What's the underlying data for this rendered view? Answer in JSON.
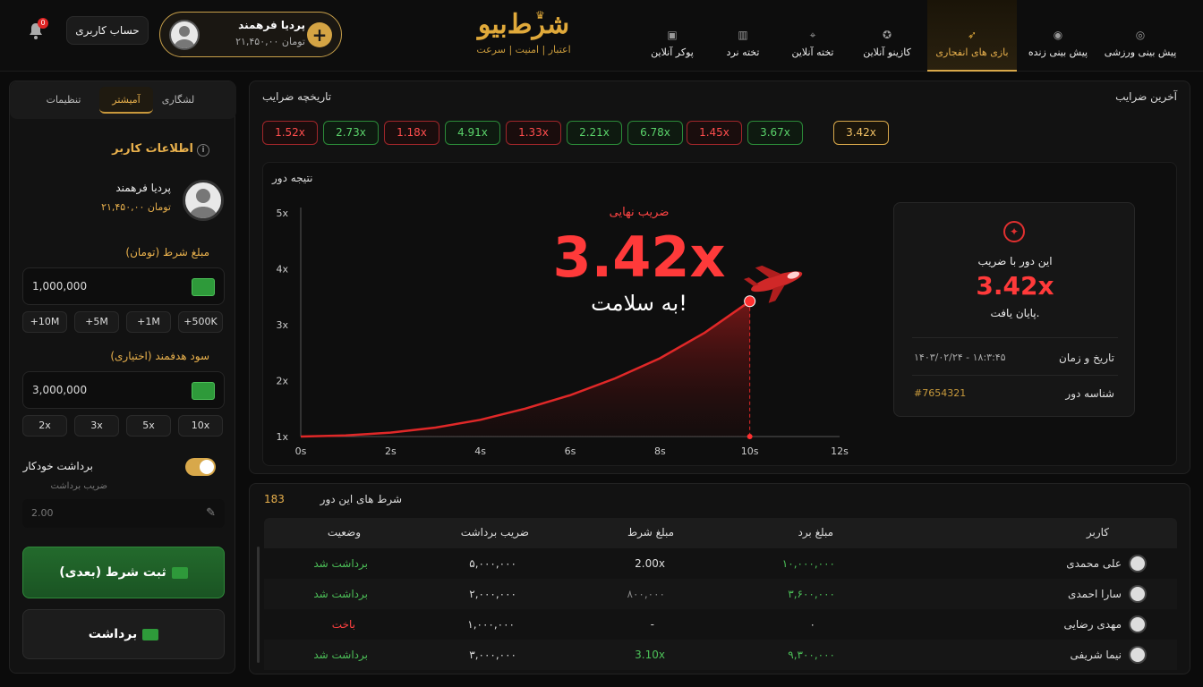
{
  "header": {
    "notification_count": "0",
    "account_button": "حساب کاربری",
    "wallet": {
      "name": "پردیا فرهمند",
      "balance": "۲۱,۴۵۰,۰۰ تومان",
      "add": "+"
    },
    "logo": {
      "title": "شرط‌بیو",
      "tagline": "اعتبار | امنیت | سرعت"
    },
    "nav": [
      {
        "label": "پیش بینی ورزشی",
        "icon": "ball-icon"
      },
      {
        "label": "پیش بینی زنده",
        "icon": "live-icon"
      },
      {
        "label": "بازی های انفجاری",
        "icon": "rocket-icon",
        "active": true
      },
      {
        "label": "کازینو آنلاین",
        "icon": "chip-icon"
      },
      {
        "label": "تخته آنلاین",
        "icon": "antenna-icon"
      },
      {
        "label": "تخته نرد",
        "icon": "board-icon"
      },
      {
        "label": "پوکر آنلاین",
        "icon": "cards-icon"
      }
    ]
  },
  "sidebar": {
    "tabs": [
      "تنظیمات",
      "آمیشتر",
      "لشگاری"
    ],
    "user_info_title": "اطلاعات کاربر",
    "user_name": "پردیا فرهمند",
    "user_balance": "۲۱,۴۵۰,۰۰ تومان",
    "bet_amount_label": "مبلغ شرط (تومان)",
    "bet_amount_value": "1,000,000",
    "amount_chips": [
      "+10M",
      "+5M",
      "+1M",
      "+500K"
    ],
    "target_label": "سود هدفمند (اختیاری)",
    "target_value": "3,000,000",
    "multiplier_chips": [
      "2x",
      "3x",
      "5x",
      "10x"
    ],
    "auto_cashout_label": "برداشت خودکار",
    "auto_cashout_sub": "ضریب برداشت",
    "auto_cashout_value": "2.00",
    "bet_button": "ثبت شرط (بعدی)",
    "cashout_button": "برداشت"
  },
  "main": {
    "history_title": "تاریخچه ضرایب",
    "last_title": "آخرین ضرایب",
    "history": [
      {
        "value": "1.52x",
        "status": "red"
      },
      {
        "value": "2.73x",
        "status": "green"
      },
      {
        "value": "1.18x",
        "status": "red"
      },
      {
        "value": "4.91x",
        "status": "green"
      },
      {
        "value": "1.33x",
        "status": "red"
      },
      {
        "value": "2.21x",
        "status": "green"
      },
      {
        "value": "6.78x",
        "status": "green"
      },
      {
        "value": "1.45x",
        "status": "red"
      },
      {
        "value": "3.67x",
        "status": "green"
      },
      {
        "value": "3.42x",
        "status": "gold"
      }
    ],
    "round_title": "نتیجه دور",
    "final_label": "ضریب نهایی",
    "final_value": "3.42x",
    "final_message": "به سلامت!",
    "info": {
      "line1": "این دور با ضریب",
      "multiplier": "3.42x",
      "line2": "پایان یافت.",
      "datetime_label": "تاریخ و زمان",
      "datetime_value": "۱۴۰۳/۰۲/۲۴ - ۱۸:۳:۴۵",
      "round_id_label": "شناسه دور",
      "round_id_value": "#7654321"
    }
  },
  "chart_data": {
    "type": "line",
    "title": "",
    "xlabel": "",
    "ylabel": "",
    "x_ticks": [
      "0s",
      "2s",
      "4s",
      "6s",
      "8s",
      "10s",
      "12s"
    ],
    "y_ticks": [
      "1x",
      "2x",
      "3x",
      "4x",
      "5x"
    ],
    "xlim": [
      0,
      12
    ],
    "ylim": [
      1,
      5
    ],
    "series": [
      {
        "x": [
          0,
          1,
          2,
          3,
          4,
          5,
          6,
          7,
          8,
          9,
          10
        ],
        "values": [
          1.0,
          1.02,
          1.07,
          1.16,
          1.3,
          1.5,
          1.74,
          2.04,
          2.4,
          2.86,
          3.42
        ]
      }
    ],
    "crash_point": {
      "x": 10,
      "y": 3.42
    },
    "grid": false,
    "color": "#e02828"
  },
  "bets": {
    "title": "شرط های این دور",
    "count": "183",
    "columns": [
      "کاربر",
      "مبلغ برد",
      "مبلغ شرط",
      "ضریب برداشت",
      "وضعیت"
    ],
    "rows": [
      {
        "user": "علی محمدی",
        "win": "۱۰,۰۰۰,۰۰۰",
        "bet": "2.00x",
        "mult": "۵,۰۰۰,۰۰۰",
        "status": "برداشت شد",
        "state": "green"
      },
      {
        "user": "سارا احمدی",
        "win": "۳,۶۰۰,۰۰۰",
        "bet": "۸۰۰,۰۰۰",
        "mult": "۲,۰۰۰,۰۰۰",
        "status": "برداشت شد",
        "state": "green"
      },
      {
        "user": "مهدی رضایی",
        "win": "۰",
        "bet": "-",
        "mult": "۱,۰۰۰,۰۰۰",
        "status": "باخت",
        "state": "red"
      },
      {
        "user": "نیما شریفی",
        "win": "۹,۳۰۰,۰۰۰",
        "bet": "3.10x",
        "mult": "۳,۰۰۰,۰۰۰",
        "status": "برداشت شد",
        "state": "green"
      }
    ]
  }
}
